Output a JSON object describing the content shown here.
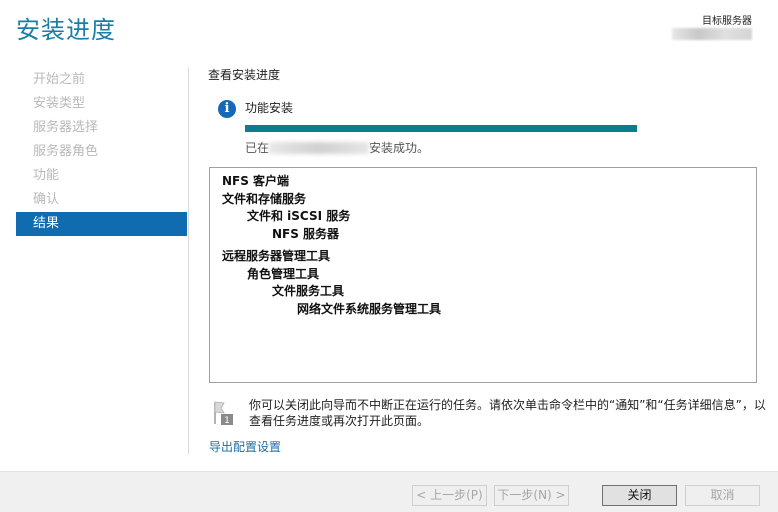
{
  "window": {
    "title": "安装进度",
    "target_label": "目标服务器"
  },
  "sidebar": {
    "items": [
      {
        "label": "开始之前"
      },
      {
        "label": "安装类型"
      },
      {
        "label": "服务器选择"
      },
      {
        "label": "服务器角色"
      },
      {
        "label": "功能"
      },
      {
        "label": "确认"
      },
      {
        "label": "结果"
      }
    ],
    "active_index": 6
  },
  "main": {
    "section_title": "查看安装进度",
    "feature_title": "功能安装",
    "progress": 1.0,
    "status_prefix": "已在",
    "status_suffix": "安装成功。",
    "results": [
      {
        "text": "NFS 客户端",
        "level": 0
      },
      {
        "text": "文件和存储服务",
        "level": 0
      },
      {
        "text": "文件和 iSCSI 服务",
        "level": 1
      },
      {
        "text": "NFS 服务器",
        "level": 2
      },
      {
        "text": "远程服务器管理工具",
        "level": 0,
        "gap_before": true
      },
      {
        "text": "角色管理工具",
        "level": 1
      },
      {
        "text": "文件服务工具",
        "level": 2
      },
      {
        "text": "网络文件系统服务管理工具",
        "level": 3
      }
    ],
    "note": "你可以关闭此向导而不中断正在运行的任务。请依次单击命令栏中的“通知”和“任务详细信息”，以查看任务进度或再次打开此页面。",
    "export_link": "导出配置设置"
  },
  "footer": {
    "prev": "< 上一步(P)",
    "next": "下一步(N) >",
    "close": "关闭",
    "cancel": "取消"
  },
  "colors": {
    "accent": "#1a7fa8",
    "nav_active": "#0f6cb0",
    "progress": "#0e7c8f",
    "info_icon": "#1669b8"
  }
}
